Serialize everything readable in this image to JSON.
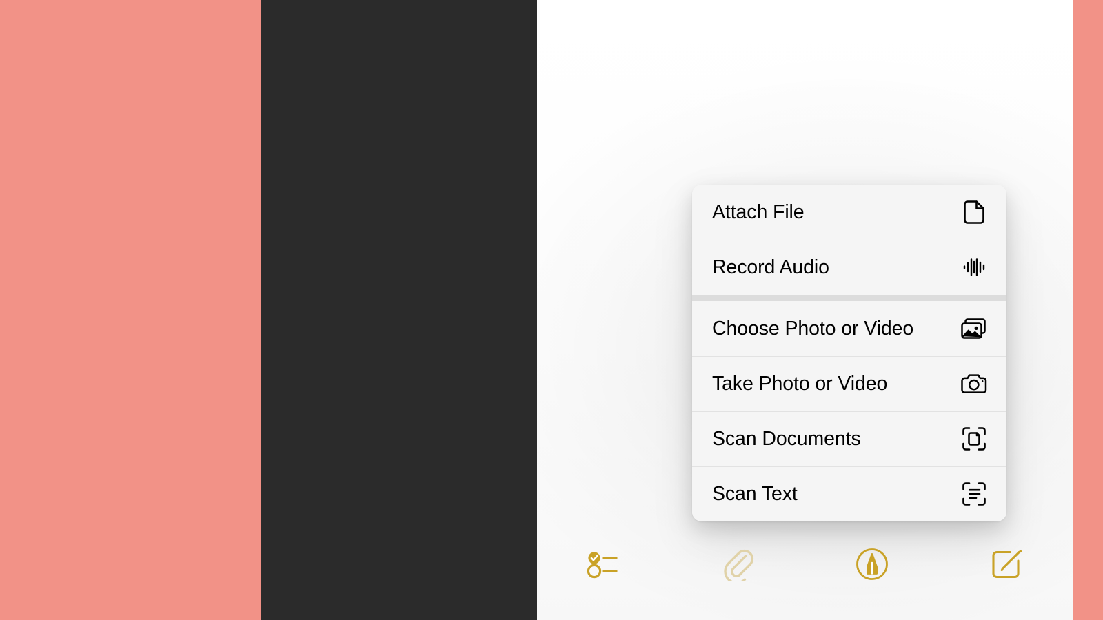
{
  "theme": {
    "page_background": "#F29287",
    "device_bezel": "#2B2B2B",
    "screen_background": "#FFFFFF",
    "menu_background": "#F5F5F5",
    "menu_separator": "#E2E2E2",
    "menu_group_gap": "#DCDCDC",
    "menu_text": "#000000",
    "toolbar_accent": "#C9A227",
    "toolbar_accent_dim": "#E0D2A8"
  },
  "attach_menu": {
    "groups": [
      {
        "items": [
          {
            "label": "Attach File",
            "icon": "document-icon"
          },
          {
            "label": "Record Audio",
            "icon": "waveform-icon"
          }
        ]
      },
      {
        "items": [
          {
            "label": "Choose Photo or Video",
            "icon": "photo-stack-icon"
          },
          {
            "label": "Take Photo or Video",
            "icon": "camera-icon"
          },
          {
            "label": "Scan Documents",
            "icon": "scan-document-icon"
          },
          {
            "label": "Scan Text",
            "icon": "scan-text-icon"
          }
        ]
      }
    ]
  },
  "bottom_toolbar": {
    "buttons": [
      {
        "name": "checklist-button",
        "icon": "checklist-icon",
        "state": "active"
      },
      {
        "name": "attach-button",
        "icon": "paperclip-icon",
        "state": "dim"
      },
      {
        "name": "markup-button",
        "icon": "markup-pen-icon",
        "state": "active"
      },
      {
        "name": "compose-button",
        "icon": "compose-icon",
        "state": "active"
      }
    ]
  }
}
